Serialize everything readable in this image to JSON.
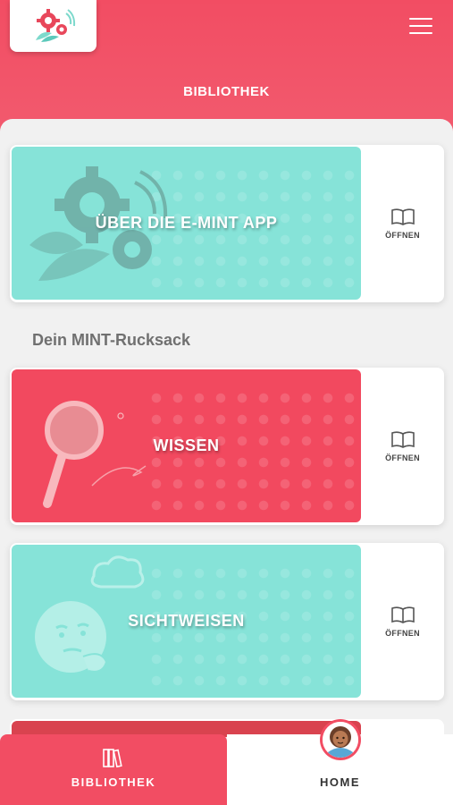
{
  "header": {
    "title": "BIBLIOTHEK",
    "logo_icon": "gear-flower-logo",
    "menu_icon": "hamburger-menu-icon",
    "color": "#f24d63"
  },
  "cards": [
    {
      "label": "ÜBER DIE E-MINT APP",
      "action": "ÖFFNEN",
      "color": "#86e3d8",
      "illustration": "gears-leaf-icon"
    },
    {
      "label": "WISSEN",
      "action": "ÖFFNEN",
      "color": "#f2495f",
      "illustration": "magnifier-icon"
    },
    {
      "label": "SICHTWEISEN",
      "action": "ÖFFNEN",
      "color": "#86e3d8",
      "illustration": "thinking-face-icon"
    }
  ],
  "section": {
    "title": "Dein MINT-Rucksack"
  },
  "bottom_nav": {
    "library_label": "BIBLIOTHEK",
    "home_label": "HOME",
    "active_color": "#f24d63"
  }
}
